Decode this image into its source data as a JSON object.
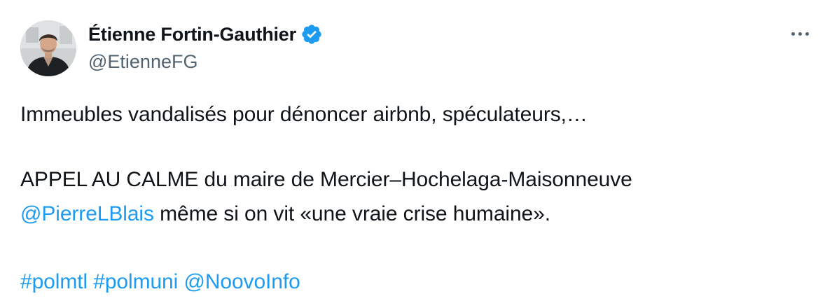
{
  "author": {
    "display_name": "Étienne Fortin-Gauthier",
    "handle": "@EtienneFG",
    "verified_icon": "verified-badge-icon",
    "verified_color": "#1d9bf0"
  },
  "menu": {
    "icon": "more-options-icon"
  },
  "tweet": {
    "line1": "Immeubles vandalisés pour dénoncer airbnb, spéculateurs,…",
    "line2": "APPEL AU CALME du maire de Mercier–Hochelaga-Maisonneuve",
    "mention1": "@PierreLBlais",
    "line3_rest": " même si on vit «une vraie crise humaine».",
    "hashtag1": "#polmtl",
    "hashtag2": "#polmuni",
    "mention2": "@NoovoInfo"
  },
  "colors": {
    "link": "#1d9bf0",
    "text": "#0f1419",
    "secondary": "#536471"
  }
}
